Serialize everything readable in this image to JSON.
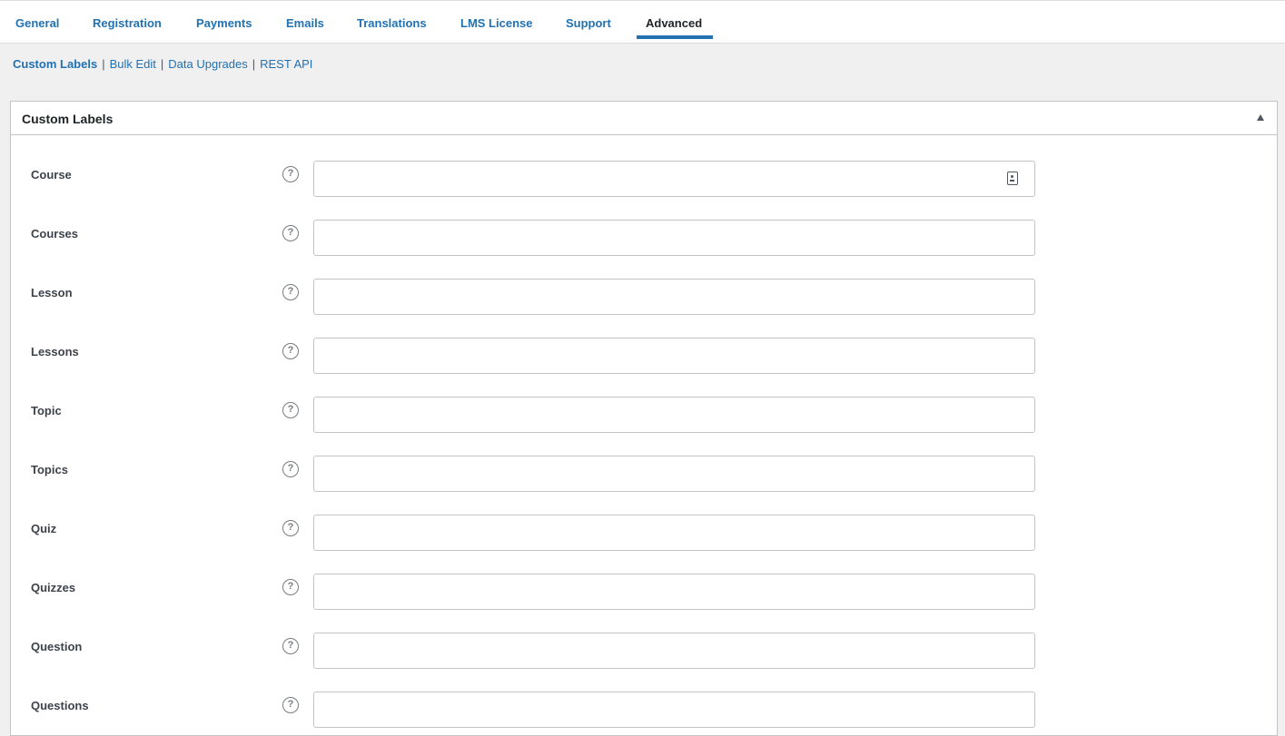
{
  "tabs": [
    {
      "label": "General"
    },
    {
      "label": "Registration"
    },
    {
      "label": "Payments"
    },
    {
      "label": "Emails"
    },
    {
      "label": "Translations"
    },
    {
      "label": "LMS License"
    },
    {
      "label": "Support"
    },
    {
      "label": "Advanced",
      "active": true
    }
  ],
  "subnav": {
    "items": [
      "Custom Labels",
      "Bulk Edit",
      "Data Upgrades",
      "REST API"
    ],
    "separator": "|"
  },
  "panel": {
    "title": "Custom Labels"
  },
  "fields": [
    {
      "label": "Course",
      "value": "",
      "help_icon": "?"
    },
    {
      "label": "Courses",
      "value": "",
      "help_icon": "?"
    },
    {
      "label": "Lesson",
      "value": "",
      "help_icon": "?"
    },
    {
      "label": "Lessons",
      "value": "",
      "help_icon": "?"
    },
    {
      "label": "Topic",
      "value": "",
      "help_icon": "?"
    },
    {
      "label": "Topics",
      "value": "",
      "help_icon": "?"
    },
    {
      "label": "Quiz",
      "value": "",
      "help_icon": "?"
    },
    {
      "label": "Quizzes",
      "value": "",
      "help_icon": "?"
    },
    {
      "label": "Question",
      "value": "",
      "help_icon": "?"
    },
    {
      "label": "Questions",
      "value": "",
      "help_icon": "?"
    }
  ],
  "colors": {
    "accent": "#2271b1",
    "background": "#f0f0f1",
    "panel": "#ffffff",
    "border": "#c3c4c7"
  }
}
